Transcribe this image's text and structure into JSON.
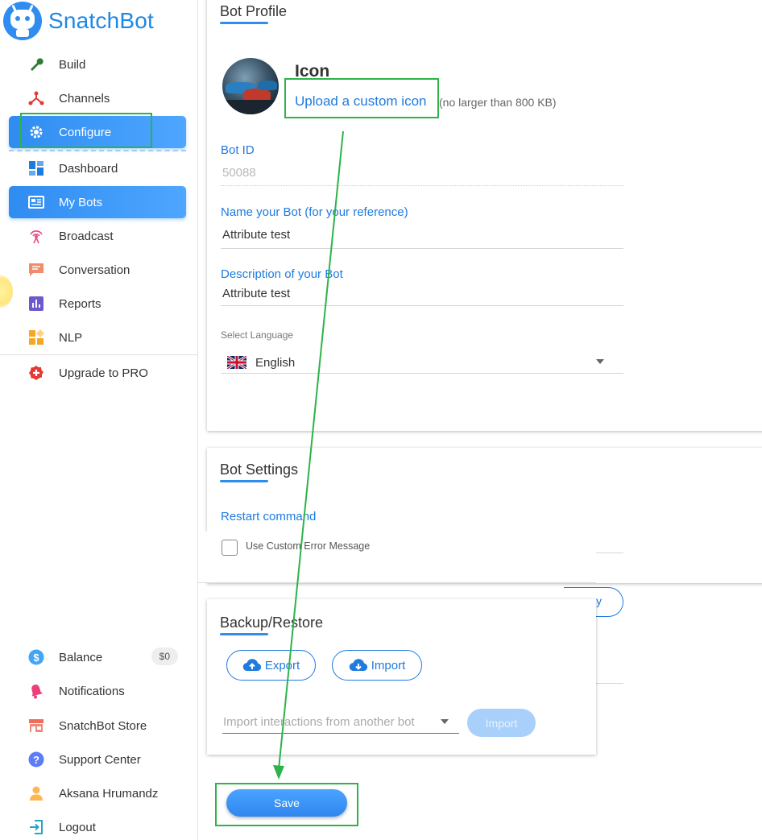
{
  "app": {
    "name": "SnatchBot"
  },
  "sidebar": {
    "items": [
      {
        "label": "Build",
        "icon": "wrench-icon"
      },
      {
        "label": "Channels",
        "icon": "channels-icon"
      },
      {
        "label": "Configure",
        "icon": "gear-icon"
      },
      {
        "label": "Dashboard",
        "icon": "dashboard-icon"
      },
      {
        "label": "My Bots",
        "icon": "bots-icon"
      },
      {
        "label": "Broadcast",
        "icon": "broadcast-icon"
      },
      {
        "label": "Conversation",
        "icon": "conversation-icon"
      },
      {
        "label": "Reports",
        "icon": "reports-icon"
      },
      {
        "label": "NLP",
        "icon": "nlp-icon"
      },
      {
        "label": "Upgrade to PRO",
        "icon": "upgrade-icon"
      }
    ],
    "bottom": [
      {
        "label": "Balance",
        "icon": "dollar-icon",
        "badge": "$0"
      },
      {
        "label": "Notifications",
        "icon": "bell-icon"
      },
      {
        "label": "SnatchBot Store",
        "icon": "store-icon"
      },
      {
        "label": "Support Center",
        "icon": "help-icon"
      },
      {
        "label": "Aksana Hrumandz",
        "icon": "user-icon"
      },
      {
        "label": "Logout",
        "icon": "logout-icon"
      }
    ]
  },
  "profile": {
    "title": "Bot Profile",
    "icon_heading": "Icon",
    "upload_link": "Upload a custom icon",
    "upload_hint": "(no larger than 800 KB)",
    "bot_id_label": "Bot ID",
    "bot_id_value": "50088",
    "name_label": "Name your Bot (for your reference)",
    "name_value": "Attribute test",
    "desc_label": "Description of your Bot",
    "desc_value": "Attribute test",
    "language_label": "Select Language",
    "language_value": "English"
  },
  "settings": {
    "title": "Bot Settings",
    "restart_label": "Restart command",
    "custom_error_label": "Use Custom Error Message",
    "partial_button_text": "y"
  },
  "backup": {
    "title": "Backup/Restore",
    "export_label": "Export",
    "import_label": "Import",
    "import_select_placeholder": "Import interactions from another bot",
    "import_button": "Import"
  },
  "save_label": "Save",
  "colors": {
    "accent": "#2f8cf0",
    "annotation": "#2db34a"
  }
}
